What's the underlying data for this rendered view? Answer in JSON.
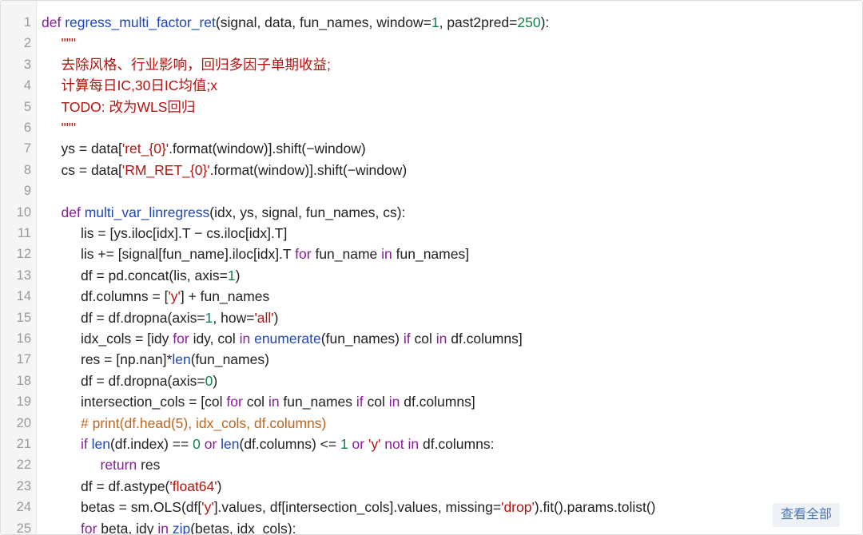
{
  "viewer": {
    "view_all_label": "查看全部"
  },
  "lines": [
    {
      "n": "1",
      "tokens": [
        [
          "kw",
          "def "
        ],
        [
          "fn",
          "regress_multi_factor_ret"
        ],
        [
          "op",
          "(signal, data, fun_names, window="
        ],
        [
          "num",
          "1"
        ],
        [
          "op",
          ", past2pred="
        ],
        [
          "num",
          "250"
        ],
        [
          "op",
          "):"
        ]
      ]
    },
    {
      "n": "2",
      "indent": 1,
      "tokens": [
        [
          "doc",
          "\"\"\""
        ]
      ]
    },
    {
      "n": "3",
      "indent": 1,
      "tokens": [
        [
          "doc",
          "去除风格、行业影响，回归多因子单期收益;"
        ]
      ]
    },
    {
      "n": "4",
      "indent": 1,
      "tokens": [
        [
          "doc",
          "计算每日IC,30日IC均值;x"
        ]
      ]
    },
    {
      "n": "5",
      "indent": 1,
      "tokens": [
        [
          "doc",
          "TODO: 改为WLS回归"
        ]
      ]
    },
    {
      "n": "6",
      "indent": 1,
      "tokens": [
        [
          "doc",
          "\"\"\""
        ]
      ]
    },
    {
      "n": "7",
      "indent": 1,
      "tokens": [
        [
          "op",
          "ys = data["
        ],
        [
          "str",
          "'ret_{0}'"
        ],
        [
          "op",
          ".format(window)].shift(−window)"
        ]
      ]
    },
    {
      "n": "8",
      "indent": 1,
      "tokens": [
        [
          "op",
          "cs = data["
        ],
        [
          "str",
          "'RM_RET_{0}'"
        ],
        [
          "op",
          ".format(window)].shift(−window)"
        ]
      ]
    },
    {
      "n": "9",
      "indent": 0,
      "tokens": []
    },
    {
      "n": "10",
      "indent": 1,
      "tokens": [
        [
          "kw",
          "def "
        ],
        [
          "fn",
          "multi_var_linregress"
        ],
        [
          "op",
          "(idx, ys, signal, fun_names, cs):"
        ]
      ]
    },
    {
      "n": "11",
      "indent": 2,
      "tokens": [
        [
          "op",
          "lis = [ys.iloc[idx].T − cs.iloc[idx].T]"
        ]
      ]
    },
    {
      "n": "12",
      "indent": 2,
      "tokens": [
        [
          "op",
          "lis += [signal[fun_name].iloc[idx].T "
        ],
        [
          "kw",
          "for"
        ],
        [
          "op",
          " fun_name "
        ],
        [
          "kw",
          "in"
        ],
        [
          "op",
          " fun_names]"
        ]
      ]
    },
    {
      "n": "13",
      "indent": 2,
      "tokens": [
        [
          "op",
          "df = pd.concat(lis, axis="
        ],
        [
          "num",
          "1"
        ],
        [
          "op",
          ")"
        ]
      ]
    },
    {
      "n": "14",
      "indent": 2,
      "tokens": [
        [
          "op",
          "df.columns = ["
        ],
        [
          "str",
          "'y'"
        ],
        [
          "op",
          "] + fun_names"
        ]
      ]
    },
    {
      "n": "15",
      "indent": 2,
      "tokens": [
        [
          "op",
          "df = df.dropna(axis="
        ],
        [
          "num",
          "1"
        ],
        [
          "op",
          ", how="
        ],
        [
          "str",
          "'all'"
        ],
        [
          "op",
          ")"
        ]
      ]
    },
    {
      "n": "16",
      "indent": 2,
      "tokens": [
        [
          "op",
          "idx_cols = [idy "
        ],
        [
          "kw",
          "for"
        ],
        [
          "op",
          " idy, col "
        ],
        [
          "kw",
          "in"
        ],
        [
          "op",
          " "
        ],
        [
          "fn",
          "enumerate"
        ],
        [
          "op",
          "(fun_names) "
        ],
        [
          "kw",
          "if"
        ],
        [
          "op",
          " col "
        ],
        [
          "kw",
          "in"
        ],
        [
          "op",
          " df.columns]"
        ]
      ]
    },
    {
      "n": "17",
      "indent": 2,
      "tokens": [
        [
          "op",
          "res = [np.nan]*"
        ],
        [
          "fn",
          "len"
        ],
        [
          "op",
          "(fun_names)"
        ]
      ]
    },
    {
      "n": "18",
      "indent": 2,
      "tokens": [
        [
          "op",
          "df = df.dropna(axis="
        ],
        [
          "num",
          "0"
        ],
        [
          "op",
          ")"
        ]
      ]
    },
    {
      "n": "19",
      "indent": 2,
      "tokens": [
        [
          "op",
          "intersection_cols = [col "
        ],
        [
          "kw",
          "for"
        ],
        [
          "op",
          " col "
        ],
        [
          "kw",
          "in"
        ],
        [
          "op",
          " fun_names "
        ],
        [
          "kw",
          "if"
        ],
        [
          "op",
          " col "
        ],
        [
          "kw",
          "in"
        ],
        [
          "op",
          " df.columns]"
        ]
      ]
    },
    {
      "n": "20",
      "indent": 2,
      "tokens": [
        [
          "cmt",
          "# print(df.head(5), idx_cols, df.columns)"
        ]
      ]
    },
    {
      "n": "21",
      "indent": 2,
      "tokens": [
        [
          "kw",
          "if "
        ],
        [
          "fn",
          "len"
        ],
        [
          "op",
          "(df.index) == "
        ],
        [
          "num",
          "0"
        ],
        [
          "kw",
          " or "
        ],
        [
          "fn",
          "len"
        ],
        [
          "op",
          "(df.columns) <= "
        ],
        [
          "num",
          "1"
        ],
        [
          "kw",
          " or "
        ],
        [
          "str",
          "'y'"
        ],
        [
          "kw",
          " not in"
        ],
        [
          "op",
          " df.columns:"
        ]
      ]
    },
    {
      "n": "22",
      "indent": 3,
      "tokens": [
        [
          "kw",
          "return"
        ],
        [
          "op",
          " res"
        ]
      ]
    },
    {
      "n": "23",
      "indent": 2,
      "tokens": [
        [
          "op",
          "df = df.astype("
        ],
        [
          "str",
          "'float64'"
        ],
        [
          "op",
          ")"
        ]
      ]
    },
    {
      "n": "24",
      "indent": 2,
      "tokens": [
        [
          "op",
          "betas = sm.OLS(df["
        ],
        [
          "str",
          "'y'"
        ],
        [
          "op",
          "].values, df[intersection_cols].values, missing="
        ],
        [
          "str",
          "'drop'"
        ],
        [
          "op",
          ").fit().params.tolist()"
        ]
      ]
    },
    {
      "n": "25",
      "indent": 2,
      "tokens": [
        [
          "kw",
          "for"
        ],
        [
          "op",
          " beta, idy "
        ],
        [
          "kw",
          "in"
        ],
        [
          "op",
          " "
        ],
        [
          "fn",
          "zip"
        ],
        [
          "op",
          "(betas, idx_cols):"
        ]
      ]
    }
  ]
}
